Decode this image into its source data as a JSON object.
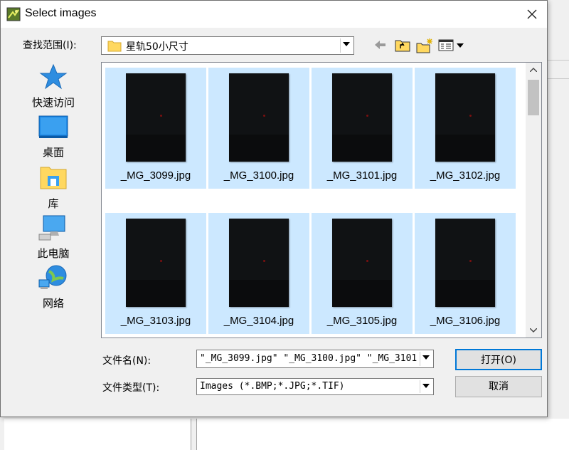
{
  "window": {
    "title": "Select images"
  },
  "lookin": {
    "label": "查找范围(I):",
    "value": "星轨50小尺寸"
  },
  "toolbar": {
    "back_icon": "back-arrow-icon",
    "up_icon": "up-folder-icon",
    "new_folder_icon": "new-folder-icon",
    "view_icon": "view-menu-icon"
  },
  "places": [
    {
      "label": "快速访问",
      "icon": "quick-access-star-icon"
    },
    {
      "label": "桌面",
      "icon": "desktop-icon"
    },
    {
      "label": "库",
      "icon": "library-icon"
    },
    {
      "label": "此电脑",
      "icon": "this-pc-icon"
    },
    {
      "label": "网络",
      "icon": "network-globe-icon"
    }
  ],
  "files": [
    "_MG_3099.jpg",
    "_MG_3100.jpg",
    "_MG_3101.jpg",
    "_MG_3102.jpg",
    "_MG_3103.jpg",
    "_MG_3104.jpg",
    "_MG_3105.jpg",
    "_MG_3106.jpg"
  ],
  "filename": {
    "label": "文件名(N):",
    "value": "\"_MG_3099.jpg\" \"_MG_3100.jpg\" \"_MG_3101"
  },
  "filetype": {
    "label": "文件类型(T):",
    "value": "Images (*.BMP;*.JPG;*.TIF)"
  },
  "buttons": {
    "open": "打开(O)",
    "cancel": "取消"
  },
  "colors": {
    "selection": "#cce8ff",
    "focus_border": "#0078d7"
  }
}
